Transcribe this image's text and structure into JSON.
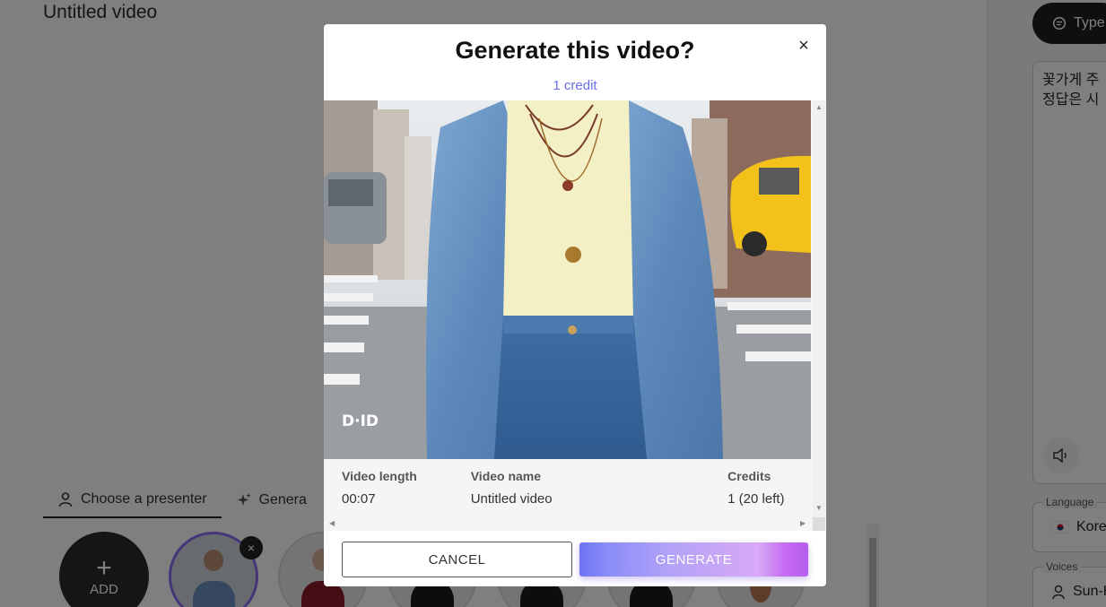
{
  "app": {
    "video_title": "Untitled video",
    "tabs": [
      {
        "label": "Choose a presenter"
      },
      {
        "label": "Genera"
      }
    ],
    "presenters": {
      "add_label": "ADD",
      "add_symbol": "+",
      "remove_symbol": "×"
    },
    "right_panel": {
      "type_button_label": "Type",
      "script_line1": "꽃가게 주",
      "script_line2": "정답은 시",
      "language_legend": "Language",
      "language_value": "Kore",
      "voices_legend": "Voices",
      "voice_value": "Sun-H"
    }
  },
  "modal": {
    "title": "Generate this video?",
    "close_symbol": "×",
    "credit_cost": "1 credit",
    "watermark": "D·ID",
    "details": {
      "length_label": "Video length",
      "length_value": "00:07",
      "name_label": "Video name",
      "name_value": "Untitled video",
      "credits_label": "Credits",
      "credits_value": "1 (20 left)"
    },
    "cancel_label": "CANCEL",
    "generate_label": "GENERATE"
  },
  "colors": {
    "accent": "#6a6ee6",
    "generate_gradient_start": "#6f74f3",
    "generate_gradient_end": "#b65df0",
    "overlay": "rgba(0,0,0,0.5)"
  }
}
